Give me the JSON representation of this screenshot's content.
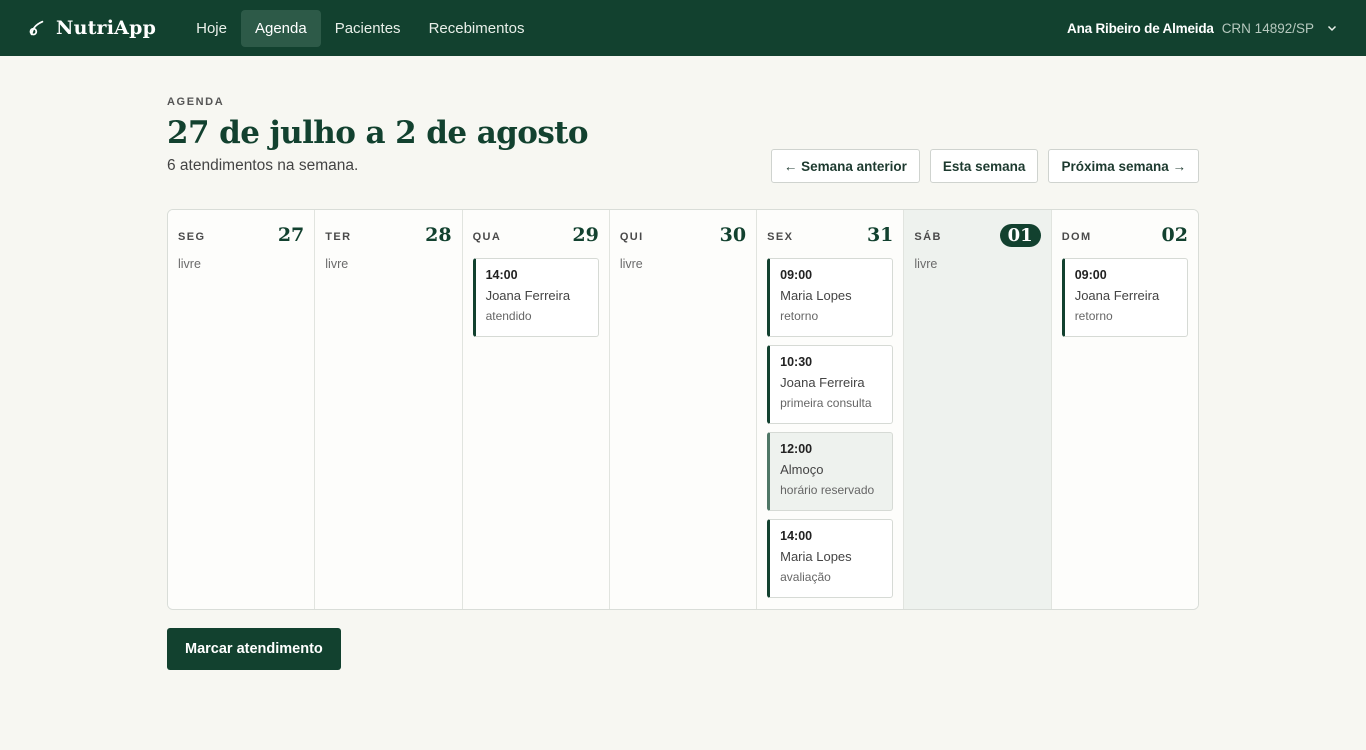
{
  "app": {
    "brand": "NutriApp",
    "brand_icon": "leaf-icon",
    "accent": "#12412f"
  },
  "nav": {
    "items": [
      {
        "label": "Hoje",
        "active": false
      },
      {
        "label": "Agenda",
        "active": true
      },
      {
        "label": "Pacientes",
        "active": false
      },
      {
        "label": "Recebimentos",
        "active": false
      }
    ]
  },
  "user": {
    "name": "Ana Ribeiro de Almeida",
    "crn": "CRN 14892/SP",
    "menu_icon": "chevron-down-icon"
  },
  "header": {
    "eyebrow": "AGENDA",
    "title": "27 de julho a 2 de agosto",
    "subtitle": "6 atendimentos na semana."
  },
  "week_nav": {
    "prev": "← Semana anterior",
    "current": "Esta semana",
    "next": "Próxima semana →"
  },
  "days": [
    {
      "label": "SEG",
      "num": "27",
      "today": false,
      "free": "livre",
      "events": []
    },
    {
      "label": "TER",
      "num": "28",
      "today": false,
      "free": "livre",
      "events": []
    },
    {
      "label": "QUA",
      "num": "29",
      "today": false,
      "free": "",
      "events": [
        {
          "time": "14:00",
          "name": "Joana Ferreira",
          "note": "atendido",
          "reserved": false
        }
      ]
    },
    {
      "label": "QUI",
      "num": "30",
      "today": false,
      "free": "livre",
      "events": []
    },
    {
      "label": "SEX",
      "num": "31",
      "today": false,
      "free": "",
      "events": [
        {
          "time": "09:00",
          "name": "Maria Lopes",
          "note": "retorno",
          "reserved": false
        },
        {
          "time": "10:30",
          "name": "Joana Ferreira",
          "note": "primeira consulta",
          "reserved": false
        },
        {
          "time": "12:00",
          "name": "Almoço",
          "note": "horário reservado",
          "reserved": true
        },
        {
          "time": "14:00",
          "name": "Maria Lopes",
          "note": "avaliação",
          "reserved": false
        }
      ]
    },
    {
      "label": "SÁB",
      "num": "01",
      "today": true,
      "free": "livre",
      "events": []
    },
    {
      "label": "DOM",
      "num": "02",
      "today": false,
      "free": "",
      "events": [
        {
          "time": "09:00",
          "name": "Joana Ferreira",
          "note": "retorno",
          "reserved": false
        }
      ]
    }
  ],
  "actions": {
    "primary": "Marcar atendimento"
  }
}
